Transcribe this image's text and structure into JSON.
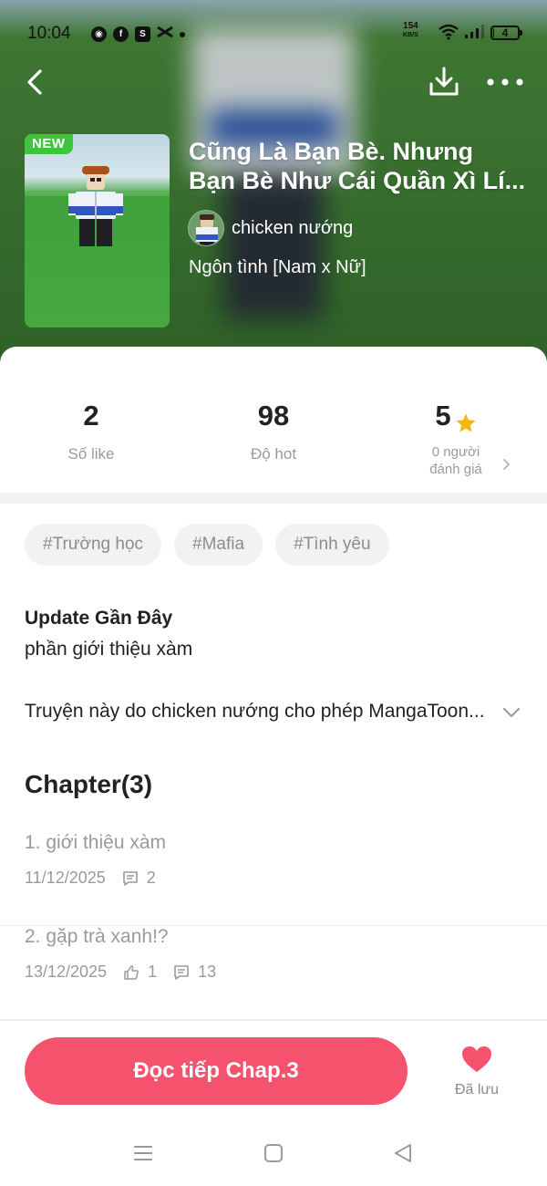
{
  "status_bar": {
    "time": "10:04",
    "net_speed_value": "154",
    "net_speed_unit": "KB/S",
    "battery": "4",
    "battery_level": 0.04,
    "app_icons": [
      "discord-icon",
      "facebook-icon",
      "shopee-icon",
      "capcut-icon",
      "notification-dot"
    ]
  },
  "header": {
    "back_icon": "chevron-left-icon",
    "download_icon": "download-icon",
    "more_icon": "more-horizontal-icon"
  },
  "book": {
    "badge": "NEW",
    "title_line1": "Cũng Là Bạn Bè. Nhưng",
    "title_line2": "Bạn Bè Như Cái Quần Xì Lí...",
    "author": "chicken nướng",
    "genre": "Ngôn tình [Nam x Nữ]"
  },
  "stats": {
    "likes_value": "2",
    "likes_label": "Số like",
    "hot_value": "98",
    "hot_label": "Độ hot",
    "rating_value": "5",
    "rating_label_1": "0 người",
    "rating_label_2": "đánh giá"
  },
  "tags": [
    "#Trường học",
    "#Mafia",
    "#Tình yêu"
  ],
  "update": {
    "title": "Update Gần Đây",
    "text": "phần giới thiệu xàm"
  },
  "permission_text": "Truyện này do chicken nướng cho phép MangaToon...",
  "chapters_heading": "Chapter(3)",
  "chapters": [
    {
      "title": "1. giới thiệu xàm",
      "date": "11/12/2025",
      "comments": "2"
    },
    {
      "title": "2. gặp trà xanh!?",
      "date": "13/12/2025",
      "likes": "1",
      "comments": "13"
    }
  ],
  "bottom": {
    "read_button": "Đọc tiếp Chap.3",
    "saved_label": "Đã lưu"
  },
  "colors": {
    "accent": "#f5526e",
    "badge_green": "#3cc63c",
    "star": "#f5b70a",
    "hero_green": "#3f7d35"
  }
}
